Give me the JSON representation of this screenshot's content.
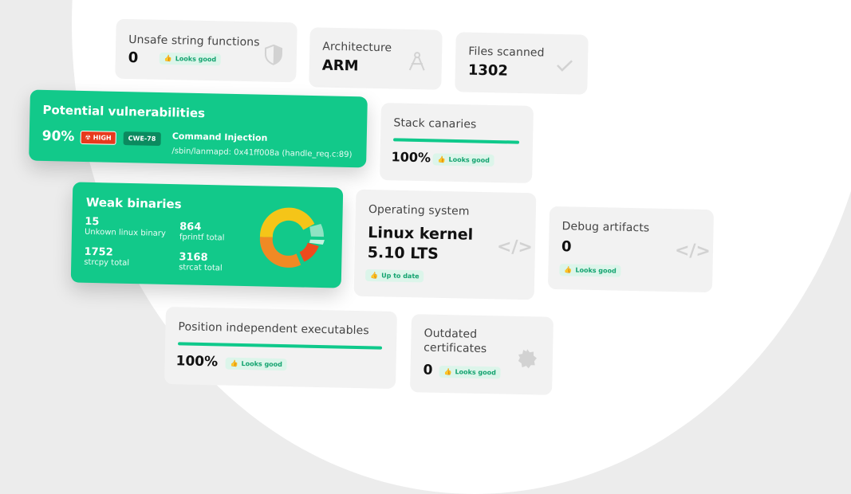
{
  "unsafe": {
    "title": "Unsafe string functions",
    "value": "0",
    "badge": "Looks good",
    "icon": "shield-icon"
  },
  "architecture": {
    "title": "Architecture",
    "value": "ARM",
    "icon": "compass-icon"
  },
  "files": {
    "title": "Files scanned",
    "value": "1302",
    "icon": "check-icon"
  },
  "vulns": {
    "title": "Potential vulnerabilities",
    "percent": "90%",
    "severity": "HIGH",
    "cwe": "CWE-78",
    "name": "Command Injection",
    "path": "/sbin/lanmapd: 0x41ff008a (handle_req.c:89)"
  },
  "canaries": {
    "title": "Stack canaries",
    "value": "100%",
    "progress": 100,
    "badge": "Looks good"
  },
  "weak": {
    "title": "Weak binaries",
    "stats": [
      {
        "value": "15",
        "label": "Unkown linux binary"
      },
      {
        "value": "864",
        "label": "fprintf total"
      },
      {
        "value": "1752",
        "label": "strcpy total"
      },
      {
        "value": "3168",
        "label": "strcat total"
      }
    ]
  },
  "os": {
    "title": "Operating system",
    "value_line1": "Linux kernel",
    "value_line2": "5.10 LTS",
    "badge": "Up to date",
    "icon": "code-icon"
  },
  "debug": {
    "title": "Debug artifacts",
    "value": "0",
    "badge": "Looks good",
    "icon": "code-icon"
  },
  "pie": {
    "title": "Position independent executables",
    "value": "100%",
    "progress": 100,
    "badge": "Looks good"
  },
  "certs": {
    "title_line1": "Outdated",
    "title_line2": "certificates",
    "value": "0",
    "badge": "Looks good",
    "icon": "badge-icon"
  },
  "colors": {
    "accent": "#12c98a",
    "high": "#e8391d",
    "donut_yellow": "#f5c518",
    "donut_orange": "#f08a24",
    "donut_red": "#ee4a1c",
    "donut_mint": "#8fe3c3"
  }
}
